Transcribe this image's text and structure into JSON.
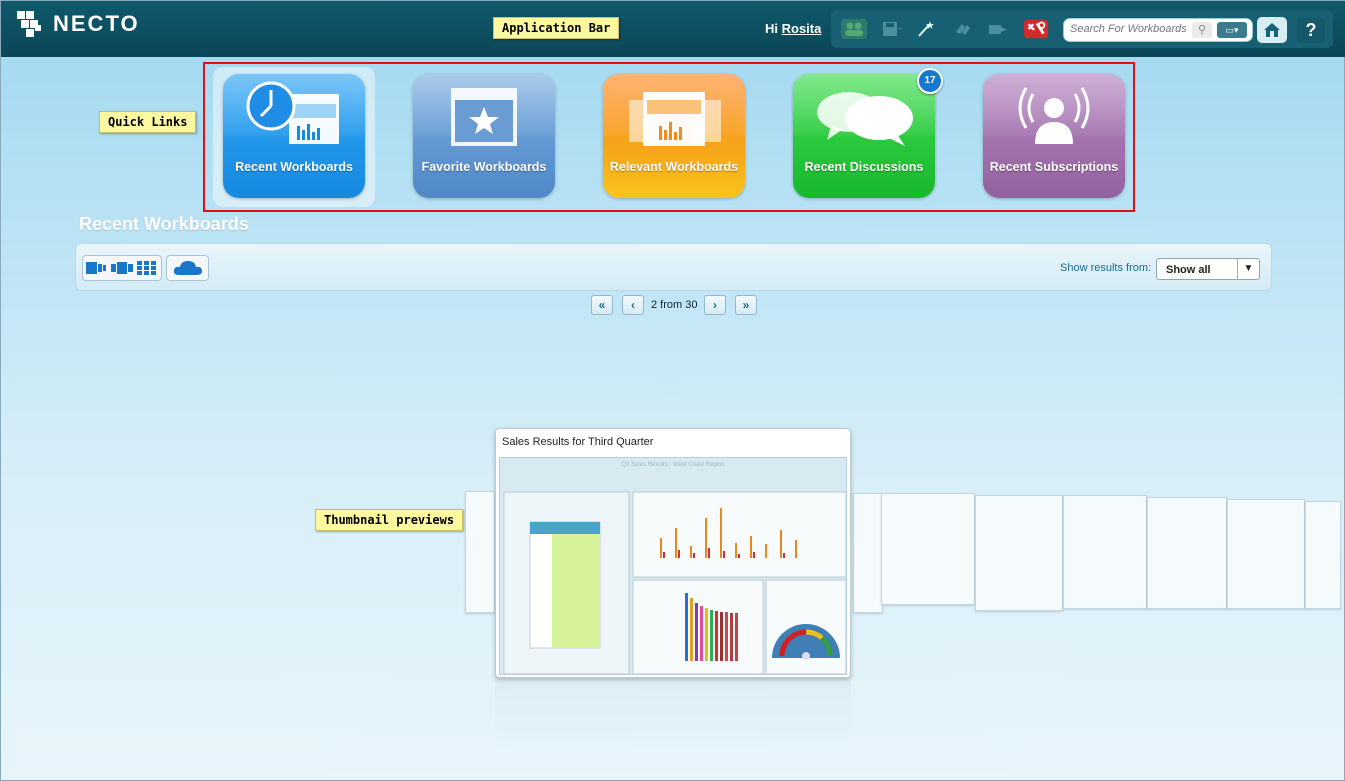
{
  "app": {
    "logo_text": "NECTO",
    "greeting_prefix": "Hi",
    "user_name": "Rosita",
    "search_placeholder": "Search For Workboards",
    "help_label": "?"
  },
  "callouts": {
    "app_bar": "Application Bar",
    "quick_links": "Quick Links",
    "thumbnails": "Thumbnail previews"
  },
  "quick_links": [
    {
      "label": "Recent Workboards",
      "color": "#1f8de6"
    },
    {
      "label": "Favorite Workboards",
      "color": "#5b95cf"
    },
    {
      "label": "Relevant Workboards",
      "color": "#f7a21a"
    },
    {
      "label": "Recent Discussions",
      "color": "#22c636",
      "badge": "17"
    },
    {
      "label": "Recent Subscriptions",
      "color": "#9c68a8"
    }
  ],
  "section": {
    "title": "Recent Workboards",
    "show_results_label": "Show results from:",
    "show_results_value": "Show all"
  },
  "pager": {
    "text": "2 from 30",
    "first": "«",
    "prev": "‹",
    "next": "›",
    "last": "»"
  },
  "thumbnail": {
    "title": "Sales Results for Third Quarter",
    "inner_title": "Q3 Sales Results - West Coast Region"
  },
  "icons": [
    "home-icon",
    "search-icon",
    "toolbar-users-icon",
    "toolbar-save-icon",
    "toolbar-wand-icon",
    "toolbar-link-icon",
    "toolbar-export-icon",
    "toolbar-tools-icon"
  ]
}
